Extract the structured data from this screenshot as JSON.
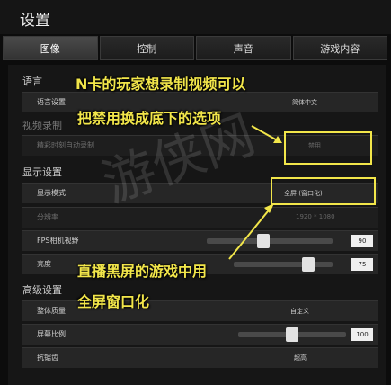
{
  "window": {
    "title": "设置"
  },
  "tabs": [
    {
      "label": "图像",
      "active": true
    },
    {
      "label": "控制",
      "active": false
    },
    {
      "label": "声音",
      "active": false
    },
    {
      "label": "游戏内容",
      "active": false
    }
  ],
  "sections": {
    "language": "语言",
    "video_record": "视频录制",
    "display": "显示设置",
    "advanced": "高级设置"
  },
  "rows": {
    "language_setting": {
      "label": "语言设置",
      "value": "简体中文"
    },
    "auto_record": {
      "label": "精彩时刻自动录制",
      "value": "禁用"
    },
    "display_mode": {
      "label": "显示模式",
      "value": "全屏 (窗口化)"
    },
    "resolution": {
      "label": "分辨率",
      "value": "1920 * 1080"
    },
    "fps_fov": {
      "label": "FPS相机视野",
      "value": "90",
      "level": 0.45
    },
    "brightness": {
      "label": "亮度",
      "value": "75",
      "level": 0.75
    },
    "overall_quality": {
      "label": "整体质量",
      "value": "自定义"
    },
    "screen_scale": {
      "label": "屏幕比例",
      "value": "100",
      "level": 0.5
    },
    "antialias": {
      "label": "抗锯齿",
      "value": "超高"
    }
  },
  "annotations": {
    "line1": "N卡的玩家想录制视频可以",
    "line2": "把禁用换成底下的选项",
    "line3": "直播黑屏的游戏中用",
    "line4": "全屏窗口化"
  },
  "watermark": "游侠网",
  "colors": {
    "highlight": "#f2e64a",
    "background": "#0c0c0c"
  }
}
